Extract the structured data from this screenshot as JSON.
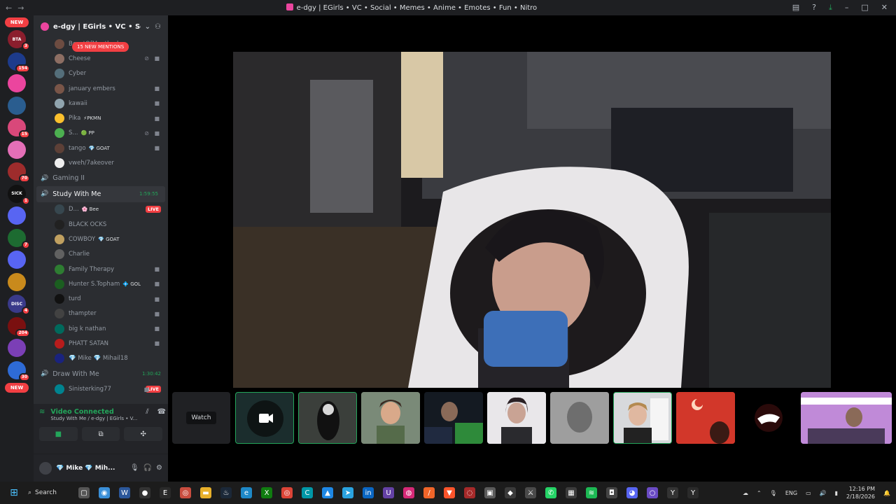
{
  "window": {
    "title": "e-dgy | EGirls • VC • Social • Memes • Anime • Emotes • Fun • Nitro",
    "back_glyph": "←",
    "forward_glyph": "→",
    "tool_icons": [
      "inbox-icon",
      "help-icon",
      "download-icon"
    ],
    "controls": [
      "–",
      "□",
      "✕"
    ]
  },
  "guild_rail": {
    "new_top": "NEW",
    "new_bottom": "NEW",
    "guilds": [
      {
        "label": "BTA",
        "badge": "3",
        "color": "#8b1e2d"
      },
      {
        "label": "",
        "badge": "154",
        "color": "#1d3b8b"
      },
      {
        "label": "",
        "badge": "",
        "color": "#eb459e"
      },
      {
        "label": "",
        "badge": "",
        "color": "#2a5d8f"
      },
      {
        "label": "",
        "badge": "15",
        "color": "#d9487a"
      },
      {
        "label": "",
        "badge": "",
        "color": "#e46fb7"
      },
      {
        "label": "",
        "badge": "70",
        "color": "#9e2c2c"
      },
      {
        "label": "SICK",
        "badge": "1",
        "color": "#111111"
      },
      {
        "label": "",
        "badge": "",
        "color": "#5865f2"
      },
      {
        "label": "",
        "badge": "7",
        "color": "#1d6b31"
      },
      {
        "label": "",
        "badge": "",
        "color": "#5865f2"
      },
      {
        "label": "",
        "badge": "",
        "color": "#c98a1c"
      },
      {
        "label": "DISC",
        "badge": "4",
        "color": "#3a3a8a"
      },
      {
        "label": "",
        "badge": "204",
        "color": "#7a1010"
      },
      {
        "label": "",
        "badge": "",
        "color": "#7b3fb6"
      },
      {
        "label": "",
        "badge": "30",
        "color": "#2e6bd6"
      }
    ]
  },
  "server": {
    "name": "e-dgy | EGirls • VC • So...",
    "new_mentions": "15 NEW MENTIONS"
  },
  "sidebar": {
    "top_users": [
      {
        "name": "BeastOfMentlord",
        "tag": "",
        "color": "#6d4c41",
        "icons": ""
      },
      {
        "name": "Cheese",
        "tag": "",
        "color": "#8d6e63",
        "icons": "mute"
      },
      {
        "name": "Cyber",
        "tag": "",
        "color": "#546e7a",
        "icons": ""
      },
      {
        "name": "january embers",
        "tag": "",
        "color": "#795548",
        "icons": "cam"
      },
      {
        "name": "kawaii",
        "tag": "",
        "color": "#90a4ae",
        "icons": "cam"
      },
      {
        "name": "Pika",
        "tag": "⚡PKMN",
        "color": "#fbc02d",
        "icons": "cam"
      },
      {
        "name": "S...",
        "tag": "🟢 PP",
        "color": "#4caf50",
        "icons": "mute"
      },
      {
        "name": "tango",
        "tag": "💎 GOAT",
        "color": "#5d4037",
        "icons": "cam"
      },
      {
        "name": "vweh/7akeover",
        "tag": "",
        "color": "#eeeeee",
        "icons": ""
      }
    ],
    "channel_gaming": "Gaming II",
    "channel_study": "Study With Me",
    "study_timer": "1:59:55",
    "study_users": [
      {
        "name": "D...",
        "tag": "🌸 Bee",
        "color": "#37474f",
        "live": true,
        "icons": ""
      },
      {
        "name": "BLACK OCKS",
        "tag": "",
        "color": "#212121",
        "live": false,
        "icons": ""
      },
      {
        "name": "COWBOY",
        "tag": "💎 GOAT",
        "color": "#c0a060",
        "live": false,
        "icons": ""
      },
      {
        "name": "Charlie",
        "tag": "",
        "color": "#616161",
        "live": false,
        "icons": ""
      },
      {
        "name": "Family Therapy",
        "tag": "",
        "color": "#2e7d32",
        "live": false,
        "icons": "cam"
      },
      {
        "name": "Hunter S.Topham",
        "tag": "💠 GOL",
        "color": "#1b5e20",
        "live": false,
        "icons": "cam"
      },
      {
        "name": "turd",
        "tag": "",
        "color": "#111111",
        "live": false,
        "icons": "cam"
      },
      {
        "name": "thampter",
        "tag": "",
        "color": "#424242",
        "live": false,
        "icons": "cam"
      },
      {
        "name": "big k nathan",
        "tag": "",
        "color": "#00695c",
        "live": false,
        "icons": "cam"
      },
      {
        "name": "PHATT SATAN",
        "tag": "",
        "color": "#b71c1c",
        "live": false,
        "icons": "cam"
      },
      {
        "name": "💎 Mike 💎 Mihail18",
        "tag": "",
        "color": "#1a237e",
        "live": false,
        "icons": ""
      }
    ],
    "channel_draw": "Draw With Me",
    "draw_timer": "1:30:42",
    "draw_users": [
      {
        "name": "Sinisterking77",
        "tag": "",
        "color": "#00838f",
        "live": true,
        "icons": "cam"
      }
    ],
    "live_label": "LIVE"
  },
  "voice_panel": {
    "status": "Video Connected",
    "channel": "Study With Me / e-dgy | EGirls • V..."
  },
  "user_panel": {
    "name": "💎 Mike 💎 Mih...",
    "sub": "m..."
  },
  "stage": {
    "watch_label": "Watch"
  },
  "taskbar": {
    "search_label": "Search",
    "lang": "ENG",
    "time": "12:16 PM",
    "date": "2/18/2026",
    "apps": [
      {
        "name": "file-icon",
        "color": "#555555",
        "glyph": "▢"
      },
      {
        "name": "browser-icon",
        "color": "#3a8fd8",
        "glyph": "◉"
      },
      {
        "name": "word-icon",
        "color": "#2b579a",
        "glyph": "W"
      },
      {
        "name": "github-icon",
        "color": "#333333",
        "glyph": "●"
      },
      {
        "name": "epic-icon",
        "color": "#2a2a2a",
        "glyph": "E"
      },
      {
        "name": "chrome-icon",
        "color": "#c94d3f",
        "glyph": "◎"
      },
      {
        "name": "folder-icon",
        "color": "#e8b02a",
        "glyph": "▬"
      },
      {
        "name": "steam-icon",
        "color": "#1b2838",
        "glyph": "♨"
      },
      {
        "name": "edge-icon",
        "color": "#1e88c7",
        "glyph": "e"
      },
      {
        "name": "xbox-icon",
        "color": "#107c10",
        "glyph": "X"
      },
      {
        "name": "chrome2-icon",
        "color": "#db4437",
        "glyph": "◎"
      },
      {
        "name": "app-icon",
        "color": "#0097a7",
        "glyph": "C"
      },
      {
        "name": "app2-icon",
        "color": "#1e88e5",
        "glyph": "▲"
      },
      {
        "name": "telegram-icon",
        "color": "#2aa3e0",
        "glyph": "➤"
      },
      {
        "name": "linkedin-icon",
        "color": "#0a66c2",
        "glyph": "in"
      },
      {
        "name": "app3-icon",
        "color": "#6441a5",
        "glyph": "U"
      },
      {
        "name": "instagram-icon",
        "color": "#d62976",
        "glyph": "◍"
      },
      {
        "name": "app4-icon",
        "color": "#f06529",
        "glyph": "/"
      },
      {
        "name": "brave-icon",
        "color": "#fb542b",
        "glyph": "▼"
      },
      {
        "name": "app5-icon",
        "color": "#a62a2a",
        "glyph": "◌"
      },
      {
        "name": "app6-icon",
        "color": "#5a5a5a",
        "glyph": "▣"
      },
      {
        "name": "app7-icon",
        "color": "#3a3a3a",
        "glyph": "◆"
      },
      {
        "name": "app8-icon",
        "color": "#4a4a4a",
        "glyph": "⚔"
      },
      {
        "name": "whatsapp-icon",
        "color": "#25d366",
        "glyph": "✆"
      },
      {
        "name": "app9-icon",
        "color": "#3b3b3b",
        "glyph": "▦"
      },
      {
        "name": "spotify-icon",
        "color": "#1db954",
        "glyph": "≋"
      },
      {
        "name": "app10-icon",
        "color": "#444444",
        "glyph": "◘"
      },
      {
        "name": "discord-icon",
        "color": "#5865f2",
        "glyph": "◕"
      },
      {
        "name": "app11-icon",
        "color": "#6a4bc4",
        "glyph": "○"
      },
      {
        "name": "app12-icon",
        "color": "#333333",
        "glyph": "Y"
      },
      {
        "name": "app13-icon",
        "color": "#2a2a2a",
        "glyph": "Y"
      }
    ]
  }
}
